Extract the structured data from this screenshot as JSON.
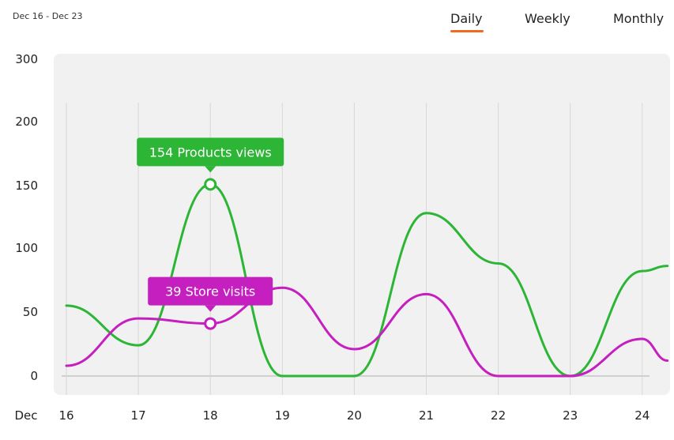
{
  "date_range": "Dec 16 - Dec 23",
  "tabs": [
    {
      "label": "Daily",
      "active": true
    },
    {
      "label": "Weekly",
      "active": false
    },
    {
      "label": "Monthly",
      "active": false
    }
  ],
  "colors": {
    "products": "#2db536",
    "store": "#c51fc0",
    "accent": "#f26a22",
    "plot_bg": "#f1f1f1",
    "grid": "#d8d8d8"
  },
  "chart_data": {
    "type": "line",
    "x": [
      16,
      17,
      18,
      19,
      20,
      21,
      22,
      23,
      24
    ],
    "x_prefix_label": "Dec",
    "y_ticks": [
      0,
      50,
      100,
      150,
      200,
      300
    ],
    "ylim": [
      0,
      300
    ],
    "grid": true,
    "series": [
      {
        "key": "products",
        "points": [
          [
            16,
            55
          ],
          [
            17,
            24
          ],
          [
            18,
            151
          ],
          [
            19,
            0
          ],
          [
            20,
            0
          ],
          [
            21,
            128
          ],
          [
            22,
            88
          ],
          [
            23,
            0
          ],
          [
            24,
            82
          ],
          [
            24.35,
            86
          ]
        ]
      },
      {
        "key": "store",
        "points": [
          [
            16,
            8
          ],
          [
            17,
            45
          ],
          [
            18,
            41
          ],
          [
            19,
            69
          ],
          [
            20,
            21
          ],
          [
            21,
            64
          ],
          [
            22,
            0
          ],
          [
            23,
            0
          ],
          [
            24,
            29
          ],
          [
            24.35,
            12
          ]
        ]
      }
    ],
    "annotations": [
      {
        "series": "products",
        "x": 18,
        "y": 151,
        "label": "154 Products views"
      },
      {
        "series": "store",
        "x": 18,
        "y": 41,
        "label": "39 Store visits"
      }
    ]
  }
}
